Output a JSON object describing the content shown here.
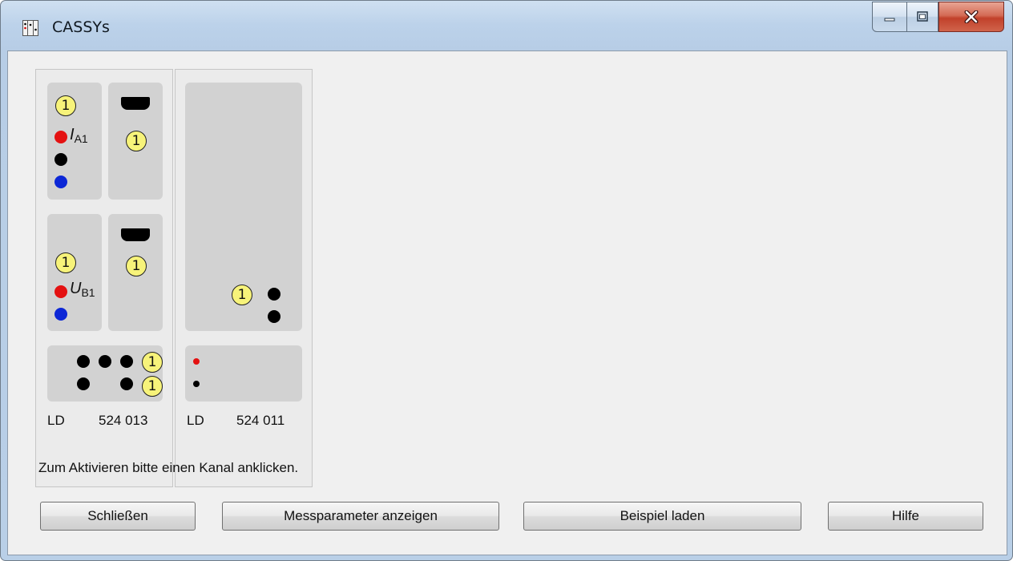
{
  "window": {
    "title": "CASSYs",
    "controls": {
      "minimize": "minimize",
      "maximize": "maximize",
      "close": "close"
    }
  },
  "cassy_modules": [
    {
      "vendor": "LD",
      "model": "524 013",
      "channel_a": {
        "input_label": "I",
        "input_sub": "A1",
        "badge": "1",
        "sensor_badge": "1"
      },
      "channel_b": {
        "input_label": "U",
        "input_sub": "B1",
        "badge": "1",
        "sensor_badge": "1"
      },
      "relay_badges": [
        "1",
        "1"
      ]
    },
    {
      "vendor": "LD",
      "model": "524 011",
      "badge": "1"
    }
  ],
  "status": {
    "hint": "Zum Aktivieren bitte einen Kanal anklicken."
  },
  "buttons": {
    "close": "Schließen",
    "show_params": "Messparameter anzeigen",
    "load_example": "Beispiel laden",
    "help": "Hilfe"
  },
  "colors": {
    "badge": "#f7f37a",
    "red_socket": "#e41111",
    "blue_socket": "#0c27d6",
    "client_bg": "#f0f0f0"
  }
}
